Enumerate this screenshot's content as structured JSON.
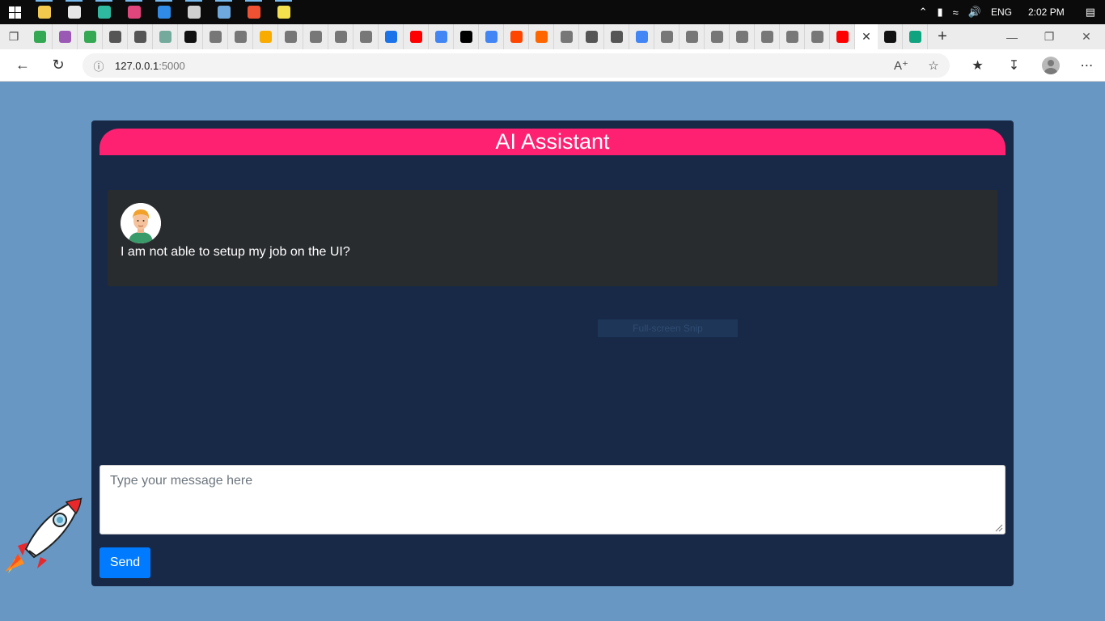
{
  "taskbar": {
    "apps": [
      {
        "name": "file-explorer",
        "color": "#f2c94c"
      },
      {
        "name": "paint",
        "color": "#e6e6e6"
      },
      {
        "name": "edge",
        "color": "#2fb9a1"
      },
      {
        "name": "slack",
        "color": "#e0457b"
      },
      {
        "name": "vscode",
        "color": "#2f8be6"
      },
      {
        "name": "cmd",
        "color": "#cfcfcf"
      },
      {
        "name": "notepad",
        "color": "#6fa8dc"
      },
      {
        "name": "git",
        "color": "#f05133"
      },
      {
        "name": "sticky-notes",
        "color": "#f4e04d"
      }
    ],
    "language": "ENG",
    "time": "2:02 PM"
  },
  "browser": {
    "tabs": [
      {
        "icon": "sheets",
        "color": "#34a853"
      },
      {
        "icon": "u",
        "color": "#9b59b6"
      },
      {
        "icon": "sheets",
        "color": "#34a853"
      },
      {
        "icon": "sparkle",
        "color": "#555555"
      },
      {
        "icon": "sparkle",
        "color": "#555555"
      },
      {
        "icon": "chatgpt",
        "color": "#74aa9c"
      },
      {
        "icon": "github",
        "color": "#111111"
      },
      {
        "icon": "github",
        "color": "#777777"
      },
      {
        "icon": "github",
        "color": "#777777"
      },
      {
        "icon": "colab",
        "color": "#f9ab00"
      },
      {
        "icon": "github",
        "color": "#777777"
      },
      {
        "icon": "github",
        "color": "#777777"
      },
      {
        "icon": "github",
        "color": "#777777"
      },
      {
        "icon": "wikipedia",
        "color": "#777777"
      },
      {
        "icon": "docs",
        "color": "#1a73e8"
      },
      {
        "icon": "youtube",
        "color": "#ff0000"
      },
      {
        "icon": "google",
        "color": "#4285f4"
      },
      {
        "icon": "medium",
        "color": "#000000"
      },
      {
        "icon": "google",
        "color": "#4285f4"
      },
      {
        "icon": "reddit",
        "color": "#ff4500"
      },
      {
        "icon": "ycombinator",
        "color": "#ff6600"
      },
      {
        "icon": "screen",
        "color": "#777777"
      },
      {
        "icon": "medium",
        "color": "#555555"
      },
      {
        "icon": "medium",
        "color": "#555555"
      },
      {
        "icon": "google",
        "color": "#4285f4"
      },
      {
        "icon": "github",
        "color": "#777777"
      },
      {
        "icon": "github",
        "color": "#777777"
      },
      {
        "icon": "github",
        "color": "#777777"
      },
      {
        "icon": "github",
        "color": "#777777"
      },
      {
        "icon": "github",
        "color": "#777777"
      },
      {
        "icon": "github",
        "color": "#777777"
      },
      {
        "icon": "github",
        "color": "#777777"
      },
      {
        "icon": "youtube",
        "color": "#ff0000"
      }
    ],
    "after_active_tabs": [
      {
        "icon": "github",
        "color": "#111111"
      },
      {
        "icon": "chatgpt",
        "color": "#10a37f"
      }
    ],
    "url_host": "127.0.0.1",
    "url_port": ":5000"
  },
  "chat": {
    "title": "AI Assistant",
    "message": "I am not able to setup my job on the UI?",
    "input_placeholder": "Type your message here",
    "send_label": "Send",
    "accent_color": "#ff2171",
    "panel_color": "#172947",
    "button_color": "#007bff"
  },
  "overlay": {
    "snip_label": "Full-screen Snip"
  }
}
